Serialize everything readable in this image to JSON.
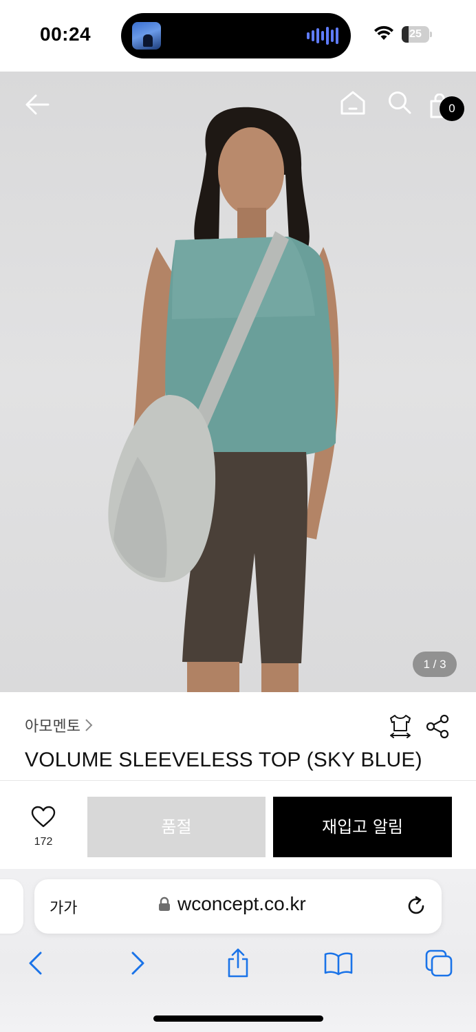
{
  "status_bar": {
    "time": "00:24",
    "battery_level": "25",
    "battery_fraction": 0.25
  },
  "hero": {
    "image_counter": "1 / 3",
    "cart_count": "0",
    "background_color": "#dcdcdd"
  },
  "product": {
    "brand": "아모멘토",
    "title": "VOLUME SLEEVELESS TOP (SKY BLUE)"
  },
  "actions": {
    "like_count": "172",
    "soldout_label": "품절",
    "restock_label": "재입고 알림"
  },
  "browser": {
    "text_size_label": "가가",
    "url": "wconcept.co.kr"
  },
  "colors": {
    "accent": "#000000",
    "soldout_bg": "#d8d8d8",
    "link_blue": "#1a73e8"
  }
}
